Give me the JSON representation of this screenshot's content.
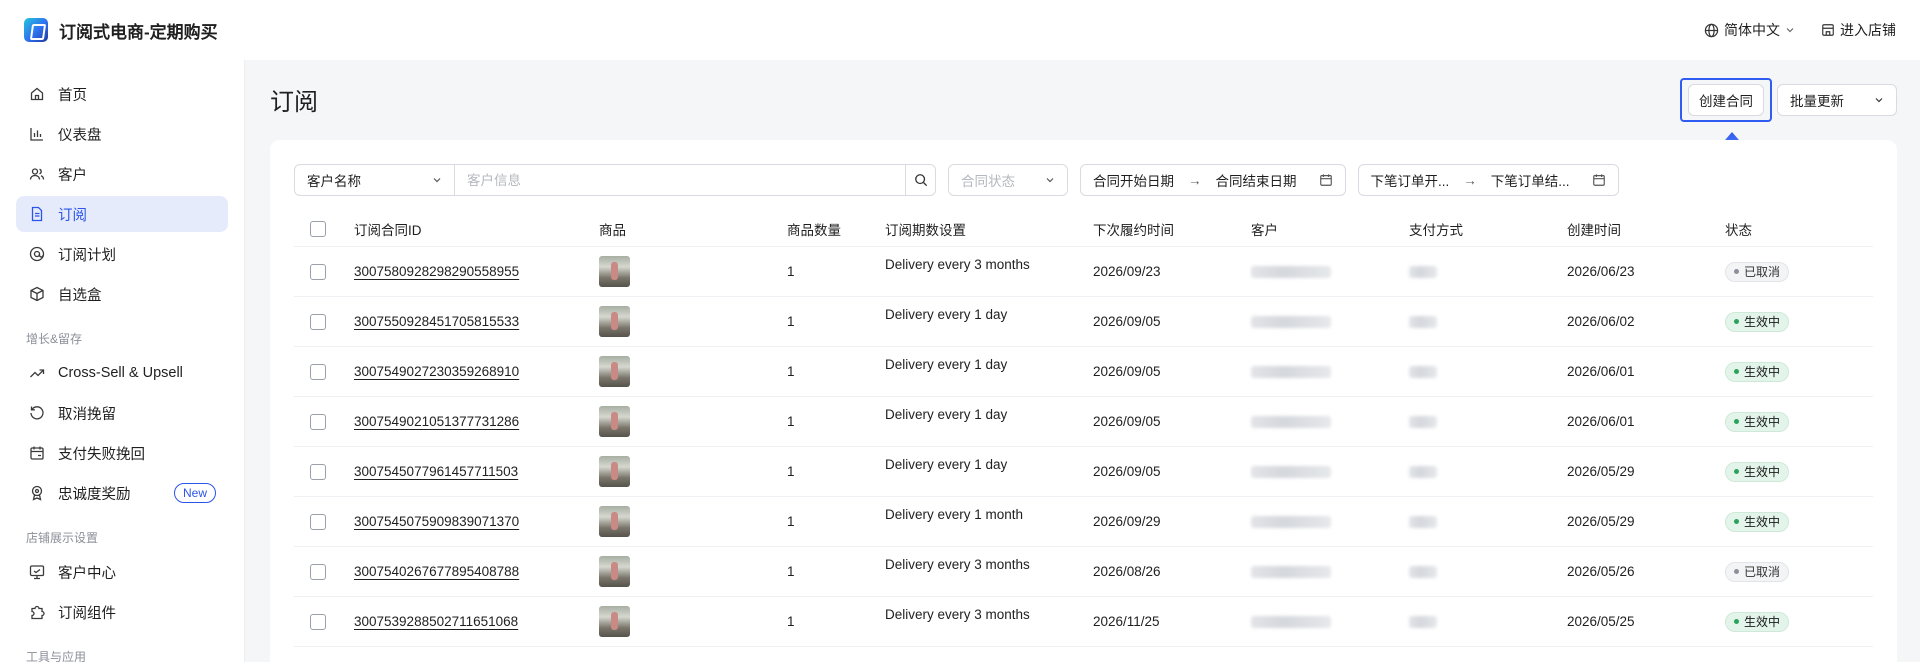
{
  "header": {
    "app_title": "订阅式电商-定期购买",
    "language": "简体中文",
    "enter_store": "进入店铺"
  },
  "sidebar": {
    "items": [
      {
        "label": "首页",
        "icon": "home-icon"
      },
      {
        "label": "仪表盘",
        "icon": "bar-chart-icon"
      },
      {
        "label": "客户",
        "icon": "users-icon"
      },
      {
        "label": "订阅",
        "icon": "document-icon",
        "active": true
      },
      {
        "label": "订阅计划",
        "icon": "at-sign-icon"
      },
      {
        "label": "自选盒",
        "icon": "box-icon"
      }
    ],
    "group_growth": "增长&留存",
    "growth_items": [
      {
        "label": "Cross-Sell & Upsell",
        "icon": "trend-up-icon"
      },
      {
        "label": "取消挽留",
        "icon": "rotate-icon"
      },
      {
        "label": "支付失败挽回",
        "icon": "calendar-card-icon"
      },
      {
        "label": "忠诚度奖励",
        "icon": "award-icon",
        "badge": "New"
      }
    ],
    "group_store": "店铺展示设置",
    "store_items": [
      {
        "label": "客户中心",
        "icon": "monitor-icon"
      },
      {
        "label": "订阅组件",
        "icon": "puzzle-icon"
      }
    ],
    "group_tools": "工具与应用"
  },
  "main": {
    "title": "订阅",
    "create_button": "创建合同",
    "bulk_button": "批量更新"
  },
  "filters": {
    "key_select": "客户名称",
    "search_placeholder": "客户信息",
    "status_placeholder": "合同状态",
    "contract_start": "合同开始日期",
    "contract_end": "合同结束日期",
    "next_order_start": "下笔订单开...",
    "next_order_end": "下笔订单结...",
    "arrow": "→"
  },
  "table": {
    "columns": [
      "订阅合同ID",
      "商品",
      "商品数量",
      "订阅期数设置",
      "下次履约时间",
      "客户",
      "支付方式",
      "创建时间",
      "状态"
    ],
    "rows": [
      {
        "id": "3007580928298290558955",
        "qty": "1",
        "cadence": "Delivery every 3 months",
        "next": "2026/09/23",
        "created": "2026/06/23",
        "status": "已取消",
        "status_type": "cancel"
      },
      {
        "id": "3007550928451705815533",
        "qty": "1",
        "cadence": "Delivery every 1 day",
        "next": "2026/09/05",
        "created": "2026/06/02",
        "status": "生效中",
        "status_type": "active"
      },
      {
        "id": "3007549027230359268910",
        "qty": "1",
        "cadence": "Delivery every 1 day",
        "next": "2026/09/05",
        "created": "2026/06/01",
        "status": "生效中",
        "status_type": "active"
      },
      {
        "id": "3007549021051377731286",
        "qty": "1",
        "cadence": "Delivery every 1 day",
        "next": "2026/09/05",
        "created": "2026/06/01",
        "status": "生效中",
        "status_type": "active"
      },
      {
        "id": "3007545077961457711503",
        "qty": "1",
        "cadence": "Delivery every 1 day",
        "next": "2026/09/05",
        "created": "2026/05/29",
        "status": "生效中",
        "status_type": "active"
      },
      {
        "id": "3007545075909839071370",
        "qty": "1",
        "cadence": "Delivery every 1 month",
        "next": "2026/09/29",
        "created": "2026/05/29",
        "status": "生效中",
        "status_type": "active"
      },
      {
        "id": "3007540267677895408788",
        "qty": "1",
        "cadence": "Delivery every 3 months",
        "next": "2026/08/26",
        "created": "2026/05/26",
        "status": "已取消",
        "status_type": "cancel"
      },
      {
        "id": "3007539288502711651068",
        "qty": "1",
        "cadence": "Delivery every 3 months",
        "next": "2026/11/25",
        "created": "2026/05/25",
        "status": "生效中",
        "status_type": "active"
      }
    ]
  },
  "colors": {
    "accent": "#2b55e8",
    "highlight": "#2f5cf1",
    "active_status": "#29a35a"
  }
}
